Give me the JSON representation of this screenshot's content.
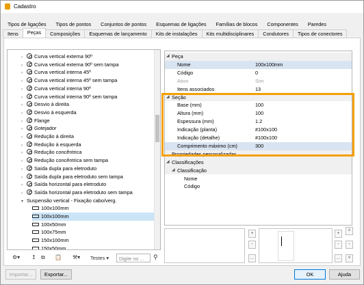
{
  "window": {
    "title": "Cadastro"
  },
  "tabs_row1": [
    "Tipos de ligações",
    "Tipos de pontos",
    "Conjuntos de pontos",
    "Esquemas de ligações",
    "Famílias de blocos",
    "Componentes",
    "Paredes"
  ],
  "tabs_row2": [
    "Itens",
    "Peças",
    "Composições",
    "Esquemas de lançamento",
    "Kits de instalações",
    "Kits multidisciplinares",
    "Condutores",
    "Tipos de conectores"
  ],
  "active_tab": "Peças",
  "tree": {
    "items": [
      {
        "label": "Curva vertical externa 90º",
        "type": "part"
      },
      {
        "label": "Curva vertical externa 90º sem tampa",
        "type": "part"
      },
      {
        "label": "Curva vertical interna 45º",
        "type": "part"
      },
      {
        "label": "Curva vertical interna 45º sem tampa",
        "type": "part"
      },
      {
        "label": "Curva vertical interna 90º",
        "type": "part"
      },
      {
        "label": "Curva vertical interna 90º sem tampa",
        "type": "part"
      },
      {
        "label": "Desvio à direita",
        "type": "part"
      },
      {
        "label": "Desvio à esquerda",
        "type": "part"
      },
      {
        "label": "Flange",
        "type": "part"
      },
      {
        "label": "Gotejador",
        "type": "part"
      },
      {
        "label": "Redução à direita",
        "type": "part"
      },
      {
        "label": "Redução à esquerda",
        "type": "part"
      },
      {
        "label": "Redução concêntrica",
        "type": "part"
      },
      {
        "label": "Redução concêntrica sem tampa",
        "type": "part"
      },
      {
        "label": "Saída dupla para eletroduto",
        "type": "part"
      },
      {
        "label": "Saída dupla para eletroduto sem tampa",
        "type": "part"
      },
      {
        "label": "Saída horizontal para eletroduto",
        "type": "part"
      },
      {
        "label": "Saída horizontal para eletroduto sem tampa",
        "type": "part"
      },
      {
        "label": "Suspensão vertical - Fixação cabo/verg.",
        "type": "group"
      },
      {
        "label": "100x100mm",
        "type": "size"
      },
      {
        "label": "100x100mm",
        "type": "size",
        "selected": true
      },
      {
        "label": "100x50mm",
        "type": "size"
      },
      {
        "label": "100x75mm",
        "type": "size"
      },
      {
        "label": "150x100mm",
        "type": "size"
      },
      {
        "label": "150x50mm",
        "type": "size"
      },
      {
        "label": "150x75mm",
        "type": "size"
      }
    ]
  },
  "tree_toolbar": {
    "tests_label": "Testes",
    "filter_placeholder": "Digite no ..."
  },
  "properties": {
    "peca_section": "Peça",
    "peca_rows": [
      {
        "key": "Nome",
        "value": "100x100mm",
        "highlight": true
      },
      {
        "key": "Código",
        "value": "0"
      },
      {
        "key": "Ativo",
        "value": "Sim",
        "dim": true
      },
      {
        "key": "Itens associados",
        "value": "13"
      }
    ],
    "secao_section": "Seção",
    "secao_rows": [
      {
        "key": "Base (mm)",
        "value": "100"
      },
      {
        "key": "Altura (mm)",
        "value": "100"
      },
      {
        "key": "Espessura (mm)",
        "value": "1.2"
      },
      {
        "key": "Indicação (planta)",
        "value": "#100x100"
      },
      {
        "key": "Indicação (detalhe)",
        "value": "#100x100"
      },
      {
        "key": "Comprimento máximo (cm)",
        "value": "300",
        "highlight": true
      }
    ],
    "custom_props": "Propriedades personalizadas",
    "classif_section": "Classificações",
    "classif_sub": "Classificação",
    "classif_rows": [
      {
        "key": "Nome"
      },
      {
        "key": "Código"
      }
    ]
  },
  "buttons": {
    "importar": "Importar...",
    "exportar": "Exportar...",
    "ok": "OK",
    "ajuda": "Ajuda",
    "add": "+",
    "remove": "-",
    "more": "..."
  },
  "colors": {
    "highlight_border": "#f5a000",
    "selection": "#cce4f7",
    "brand_icon": "#e8a000"
  }
}
